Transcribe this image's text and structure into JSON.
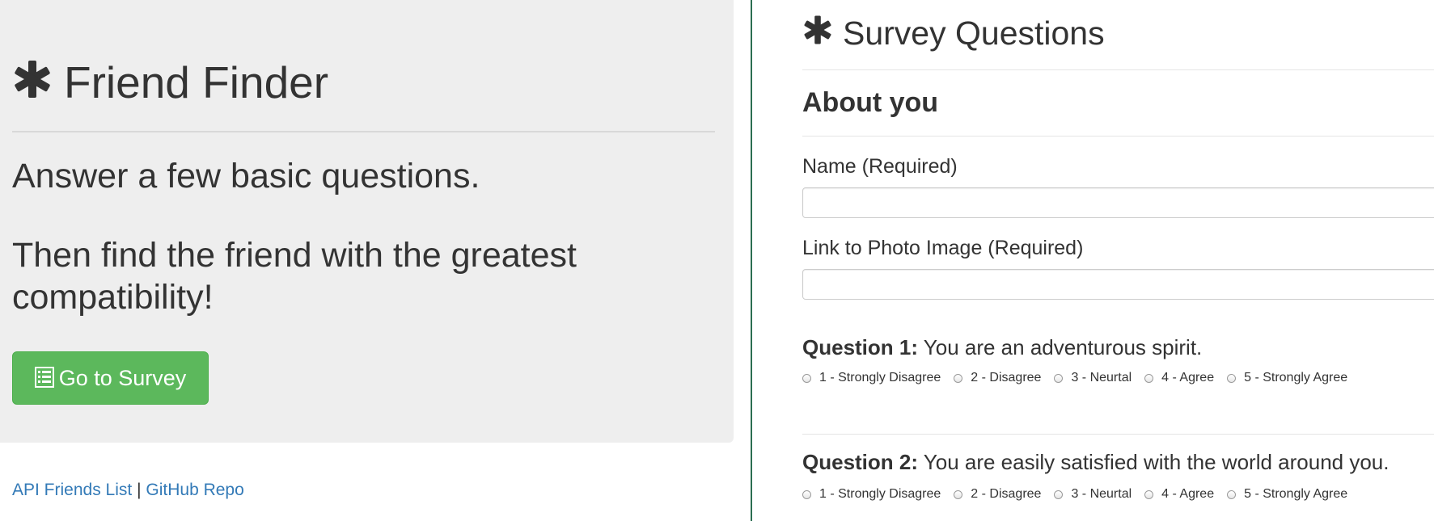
{
  "jumbotron": {
    "title": "Friend Finder",
    "icon": "asterisk-icon",
    "lead_1": "Answer a few basic questions.",
    "lead_2": "Then find the friend with the greatest compatibility!",
    "button_label": "Go to Survey",
    "button_icon": "list-icon",
    "button_color": "#5cb85c"
  },
  "footer": {
    "api_link": "API Friends List",
    "separator": "|",
    "github_link": "GitHub Repo",
    "link_color": "#337ab7"
  },
  "survey": {
    "title": "Survey Questions",
    "icon": "asterisk-icon",
    "section_title": "About you",
    "name_label": "Name (Required)",
    "name_value": "",
    "photo_label": "Link to Photo Image (Required)",
    "photo_value": "",
    "questions": [
      {
        "prefix": "Question 1:",
        "text": "You are an adventurous spirit.",
        "options": [
          "1 - Strongly Disagree",
          "2 - Disagree",
          "3 - Neurtal",
          "4 - Agree",
          "5 - Strongly Agree"
        ]
      },
      {
        "prefix": "Question 2:",
        "text": "You are easily satisfied with the world around you.",
        "options": [
          "1 - Strongly Disagree",
          "2 - Disagree",
          "3 - Neurtal",
          "4 - Agree",
          "5 - Strongly Agree"
        ]
      }
    ]
  },
  "divider_color": "#2c6e52"
}
